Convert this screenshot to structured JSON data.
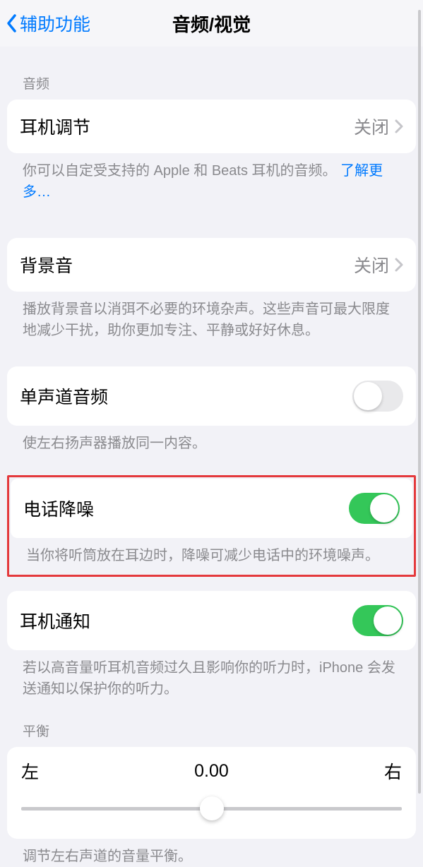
{
  "nav": {
    "back": "辅助功能",
    "title": "音频/视觉"
  },
  "sections": {
    "audio_header": "音频",
    "headphone_accom": {
      "label": "耳机调节",
      "value": "关闭"
    },
    "headphone_accom_footer": "你可以自定受支持的 Apple 和 Beats 耳机的音频。",
    "learn_more": "了解更多…",
    "background_sounds": {
      "label": "背景音",
      "value": "关闭"
    },
    "background_sounds_footer": "播放背景音以消弭不必要的环境杂声。这些声音可最大限度地减少干扰，助你更加专注、平静或好好休息。",
    "mono_audio": {
      "label": "单声道音频"
    },
    "mono_audio_footer": "使左右扬声器播放同一内容。",
    "phone_noise": {
      "label": "电话降噪"
    },
    "phone_noise_footer": "当你将听筒放在耳边时，降噪可减少电话中的环境噪声。",
    "headphone_notify": {
      "label": "耳机通知"
    },
    "headphone_notify_footer": "若以高音量听耳机音频过久且影响你的听力时，iPhone 会发送通知以保护你的听力。",
    "balance_header": "平衡",
    "balance": {
      "left": "左",
      "right": "右",
      "value": "0.00"
    },
    "balance_footer": "调节左右声道的音量平衡。"
  }
}
